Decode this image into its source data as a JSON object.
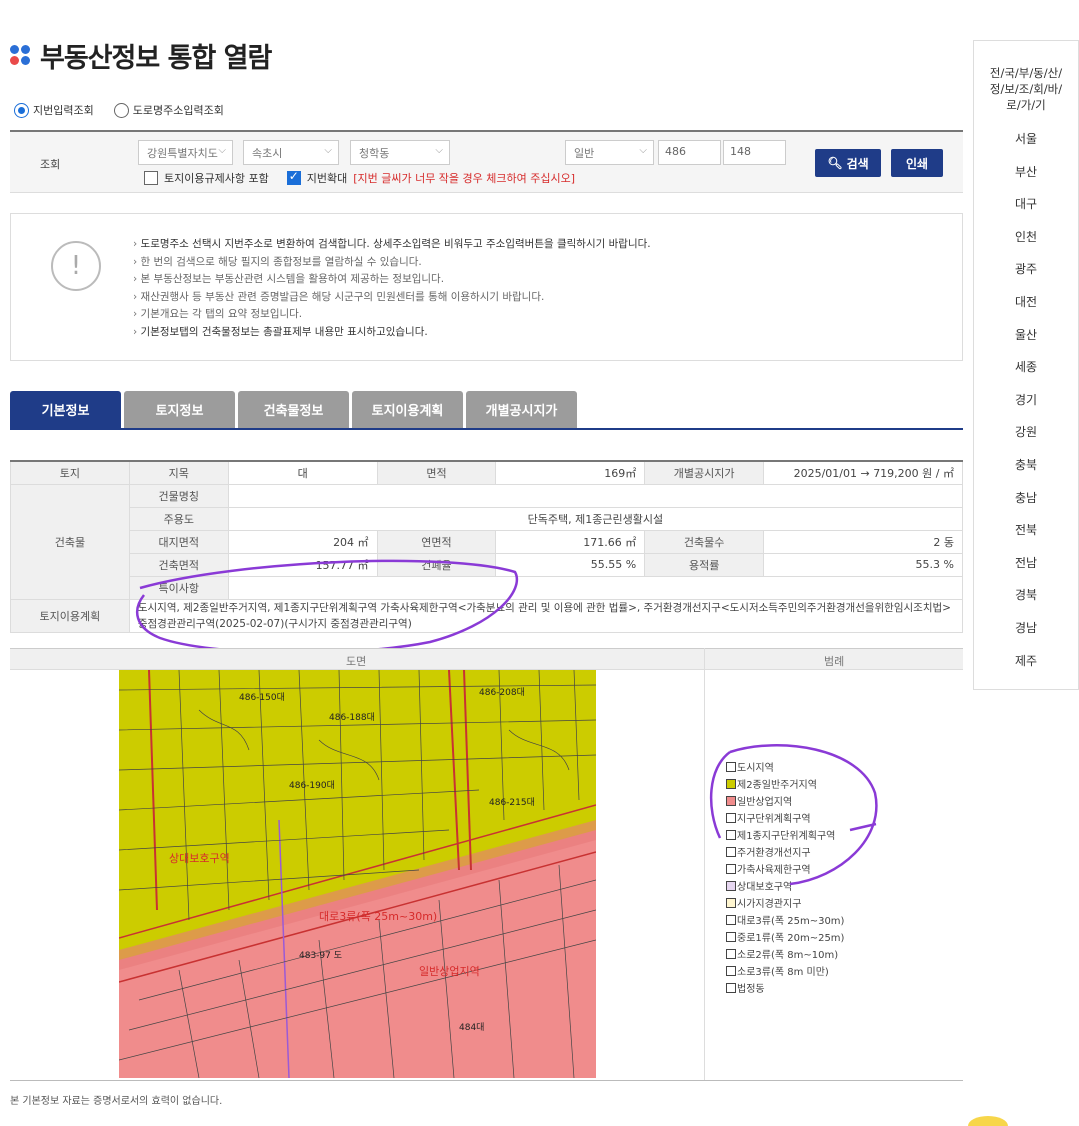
{
  "page": {
    "title": "부동산정보 통합 열람"
  },
  "search_mode": {
    "jibun": "지번입력조회",
    "road": "도로명주소입력조회"
  },
  "search": {
    "label": "조회",
    "sido": "강원특별자치도",
    "sigungu": "속초시",
    "dong": "청학동",
    "type": "일반",
    "bon": "486",
    "dash": "-",
    "bu": "148",
    "chk_land_label": "토지이용규제사항 포함",
    "chk_zoom_label": "지번확대",
    "chk_zoom_note": "[지번 글씨가 너무 작을 경우 체크하여 주십시오]",
    "search_btn": "검색",
    "print_btn": "인쇄"
  },
  "notice": {
    "icon_glyph": "!",
    "items": [
      "도로명주소 선택시 지번주소로 변환하여 검색합니다. 상세주소입력은 비워두고 주소입력버튼을 클릭하시기 바랍니다.",
      "한 번의 검색으로 해당 필지의 종합정보를 열람하실 수 있습니다.",
      "본 부동산정보는 부동산관련 시스템을 활용하여 제공하는 정보입니다.",
      "재산권행사 등 부동산 관련 증명발급은 해당 시군구의 민원센터를 통해 이용하시기 바랍니다.",
      "기본개요는 각 탭의 요약 정보입니다.",
      "기본정보탭의 건축물정보는 총괄표제부 내용만 표시하고있습니다."
    ]
  },
  "tabs": [
    "기본정보",
    "토지정보",
    "건축물정보",
    "토지이용계획",
    "개별공시지가"
  ],
  "info": {
    "land": "토지",
    "jimok_h": "지목",
    "jimok": "대",
    "area_h": "면적",
    "area": "169㎡",
    "price_h": "개별공시지가",
    "price": "2025/01/01 → 719,200 원 / ㎡",
    "building": "건축물",
    "bname_h": "건물명칭",
    "bname": "",
    "use_h": "주용도",
    "use": "단독주택, 제1종근린생활시설",
    "site_h": "대지면적",
    "site": "204 ㎡",
    "floor_h": "연면적",
    "floor": "171.66 ㎡",
    "count_h": "건축물수",
    "count": "2 동",
    "barea_h": "건축면적",
    "barea": "157.77 ㎡",
    "bcr_h": "건폐율",
    "bcr": "55.55 %",
    "far_h": "용적률",
    "far": "55.3 %",
    "special_h": "특이사항",
    "special": "",
    "plan_h": "토지이용계획",
    "plan": "도시지역, 제2종일반주거지역, 제1종지구단위계획구역 가축사육제한구역<가축분뇨의 관리 및 이용에 관한 법률>, 주거환경개선지구<도시저소득주민의주거환경개선을위한임시조치법> 중점경관관리구역(2025-02-07)(구시가지 중점경관관리구역)"
  },
  "map": {
    "head_map": "도면",
    "head_legend": "범례",
    "labels": {
      "a": "486-188대",
      "b": "486-215대",
      "c": "486-190대",
      "zone_sang": "상대보호구역",
      "zone_road": "대로3류(폭 25m~30m)",
      "lot1": "483-97 도",
      "zone_comm": "일반상업지역",
      "lot2": "484대",
      "lot3": "486-150대",
      "lot4": "486-208대"
    }
  },
  "legend": [
    {
      "label": "도시지역",
      "color": "#ffffff"
    },
    {
      "label": "제2종일반주거지역",
      "color": "#cccc00"
    },
    {
      "label": "일반상업지역",
      "color": "#f08c8c"
    },
    {
      "label": "지구단위계획구역",
      "color": "#ffffff"
    },
    {
      "label": "제1종지구단위계획구역",
      "color": "#ffffff"
    },
    {
      "label": "주거환경개선지구",
      "color": "#ffffff"
    },
    {
      "label": "가축사육제한구역",
      "color": "#ffffff"
    },
    {
      "label": "상대보호구역",
      "color": "#e6d6f0"
    },
    {
      "label": "시가지경관지구",
      "color": "#fff6d0"
    },
    {
      "label": "대로3류(폭 25m~30m)",
      "color": "#ffffff"
    },
    {
      "label": "중로1류(폭 20m~25m)",
      "color": "#ffffff"
    },
    {
      "label": "소로2류(폭 8m~10m)",
      "color": "#ffffff"
    },
    {
      "label": "소로3류(폭 8m 미만)",
      "color": "#ffffff"
    },
    {
      "label": "법정동",
      "color": "#ffffff"
    }
  ],
  "footnote": "본 기본정보 자료는 증명서로서의 효력이 없습니다.",
  "sidebar": {
    "head": "전/국/부/동/산/정/보/조/회/바/로/가/기",
    "regions": [
      "서울",
      "부산",
      "대구",
      "인천",
      "광주",
      "대전",
      "울산",
      "세종",
      "경기",
      "강원",
      "충북",
      "충남",
      "전북",
      "전남",
      "경북",
      "경남",
      "제주"
    ]
  },
  "colors": {
    "accent": "#1f3c88",
    "residential": "#cccc00",
    "commercial": "#f08c8c",
    "annotation": "#8a3ad6"
  }
}
